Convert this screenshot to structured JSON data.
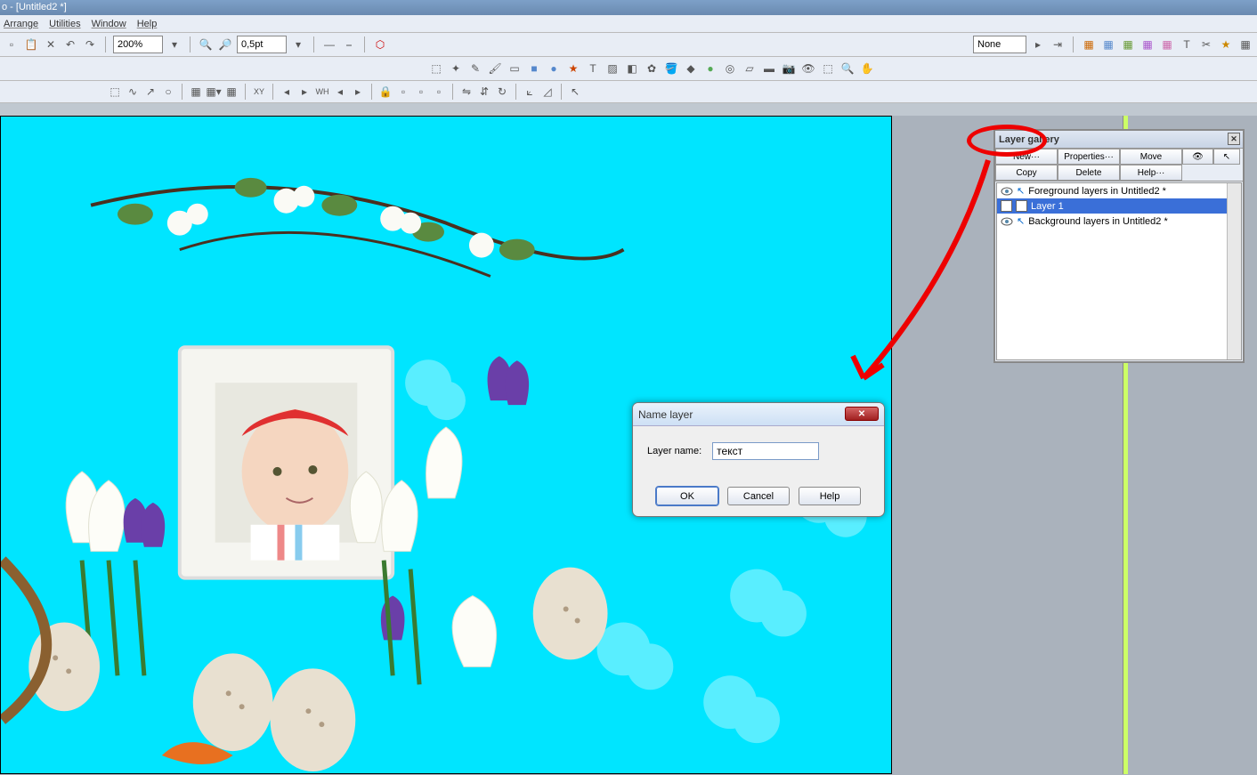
{
  "titlebar": {
    "text": "o - [Untitled2 *]"
  },
  "menu": {
    "arrange": "Arrange",
    "utilities": "Utilities",
    "window": "Window",
    "help": "Help"
  },
  "toolbar": {
    "zoom": "200%",
    "stroke": "0,5pt",
    "none": "None"
  },
  "gallery": {
    "title": "Layer gallery",
    "btn_new": "New···",
    "btn_properties": "Properties···",
    "btn_move": "Move",
    "btn_copy": "Copy",
    "btn_delete": "Delete",
    "btn_help": "Help···",
    "row_fg": "Foreground layers in Untitled2 *",
    "row_layer1": "Layer 1",
    "row_bg": "Background layers in Untitled2 *"
  },
  "dialog": {
    "title": "Name layer",
    "label": "Layer name:",
    "value": "текст",
    "ok": "OK",
    "cancel": "Cancel",
    "help": "Help"
  }
}
